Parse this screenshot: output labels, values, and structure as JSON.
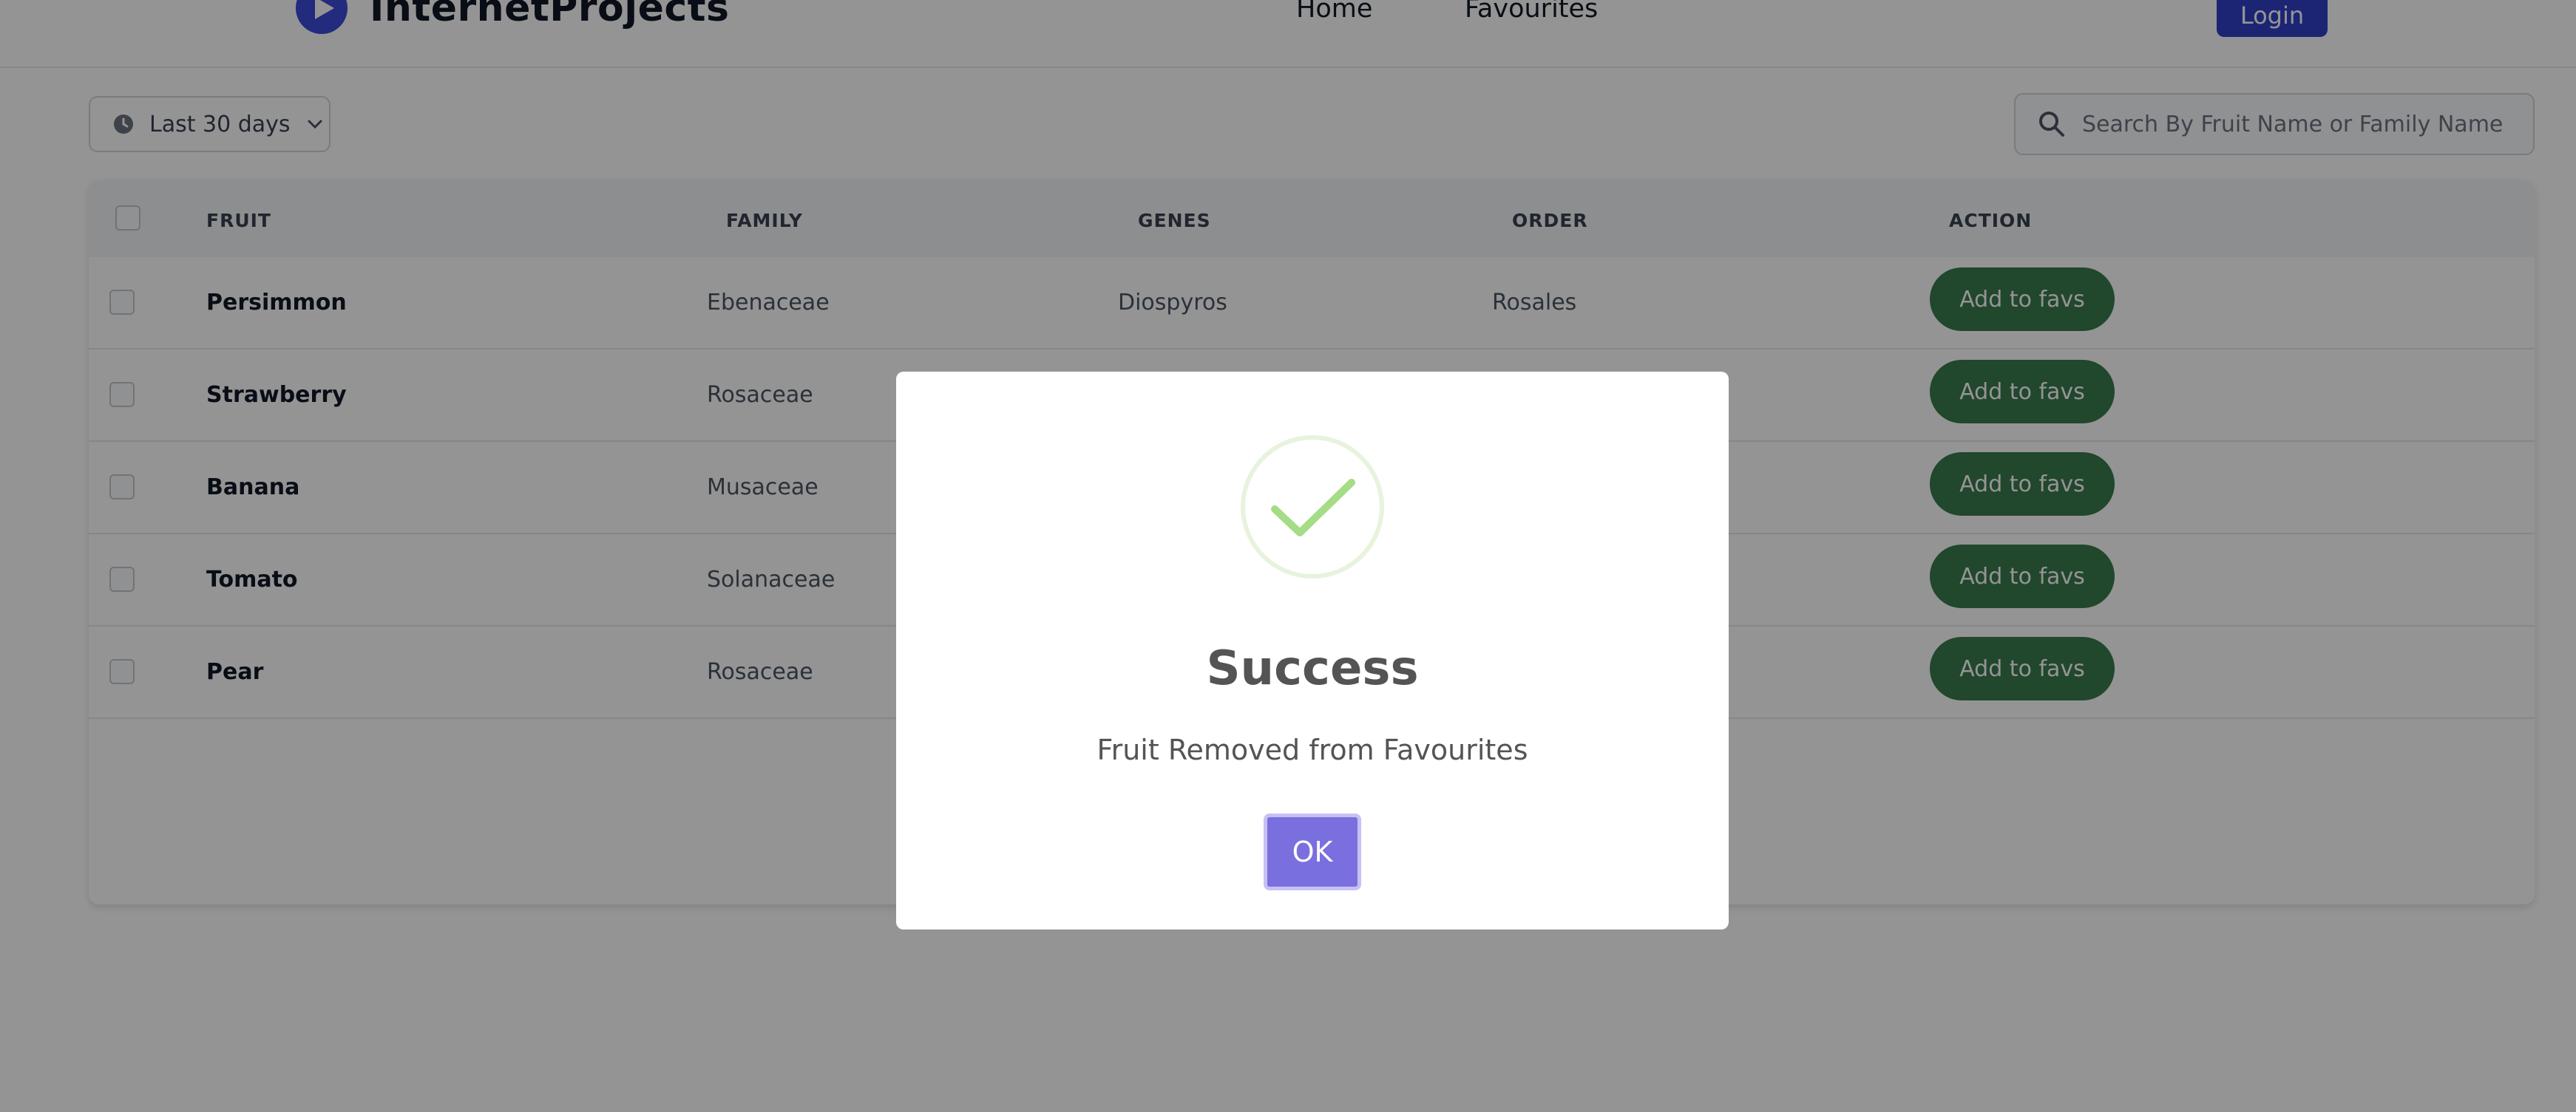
{
  "header": {
    "brand": "InternetProjects",
    "nav": {
      "home": "Home",
      "favourites": "Favourites"
    },
    "login_label": "Login"
  },
  "toolbar": {
    "date_filter": "Last 30 days",
    "search_placeholder": "Search By Fruit Name or Family Name"
  },
  "table": {
    "columns": {
      "fruit": "FRUIT",
      "family": "FAMILY",
      "genes": "GENES",
      "order": "ORDER",
      "action": "ACTION"
    },
    "rows": [
      {
        "fruit": "Persimmon",
        "family": "Ebenaceae",
        "genes": "Diospyros",
        "order": "Rosales",
        "action": "Add to favs"
      },
      {
        "fruit": "Strawberry",
        "family": "Rosaceae",
        "genes": "",
        "order": "",
        "action": "Add to favs"
      },
      {
        "fruit": "Banana",
        "family": "Musaceae",
        "genes": "",
        "order": "",
        "action": "Add to favs"
      },
      {
        "fruit": "Tomato",
        "family": "Solanaceae",
        "genes": "",
        "order": "",
        "action": "Add to favs"
      },
      {
        "fruit": "Pear",
        "family": "Rosaceae",
        "genes": "",
        "order": "",
        "action": "Add to favs"
      }
    ]
  },
  "modal": {
    "icon": "check-icon",
    "title": "Success",
    "message": "Fruit Removed from Favourites",
    "ok_label": "OK"
  },
  "colors": {
    "brand": "#3140c8",
    "fav_button": "#3a7a4f",
    "ok_button": "#7a6fde",
    "success_check": "#a5dc86"
  }
}
